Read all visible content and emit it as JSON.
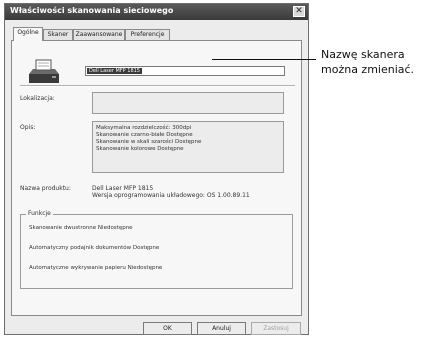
{
  "window": {
    "title": "Właściwości skanowania sieciowego",
    "close_glyph": "✕"
  },
  "tabs": [
    {
      "label": "Ogólne",
      "active": true
    },
    {
      "label": "Skaner",
      "active": false
    },
    {
      "label": "Zaawansowane",
      "active": false
    },
    {
      "label": "Preferencje",
      "active": false
    }
  ],
  "general": {
    "scanner_name": "Dell Laser MFP 1815",
    "location_label": "Lokalizacja:",
    "location_value": "",
    "description_label": "Opis:",
    "description_lines": [
      "Maksymalna rozdzielczość: 300dpi",
      "Skanowanie czarno-białe Dostępne",
      "Skanowanie w skali szarości Dostępne",
      "Skanowanie kolorowe Dostępne"
    ],
    "product_label": "Nazwa produktu:",
    "product_name": "Dell Laser MFP 1815",
    "firmware": "Wersja oprogramowania układowego: OS 1.00.89.11"
  },
  "functions": {
    "legend": "Funkcje",
    "items": [
      "Skanowanie dwustronne Niedostępne",
      "Automatyczny podajnik dokumentów Dostępne",
      "Automatyczne wykrywanie papieru Niedostępne"
    ]
  },
  "buttons": {
    "ok": "OK",
    "cancel": "Anuluj",
    "apply": "Zastosuj"
  },
  "callout": {
    "line1": "Nazwę skanera",
    "line2": "można zmieniać."
  },
  "icons": {
    "printer": "printer-icon",
    "close": "close-icon"
  }
}
